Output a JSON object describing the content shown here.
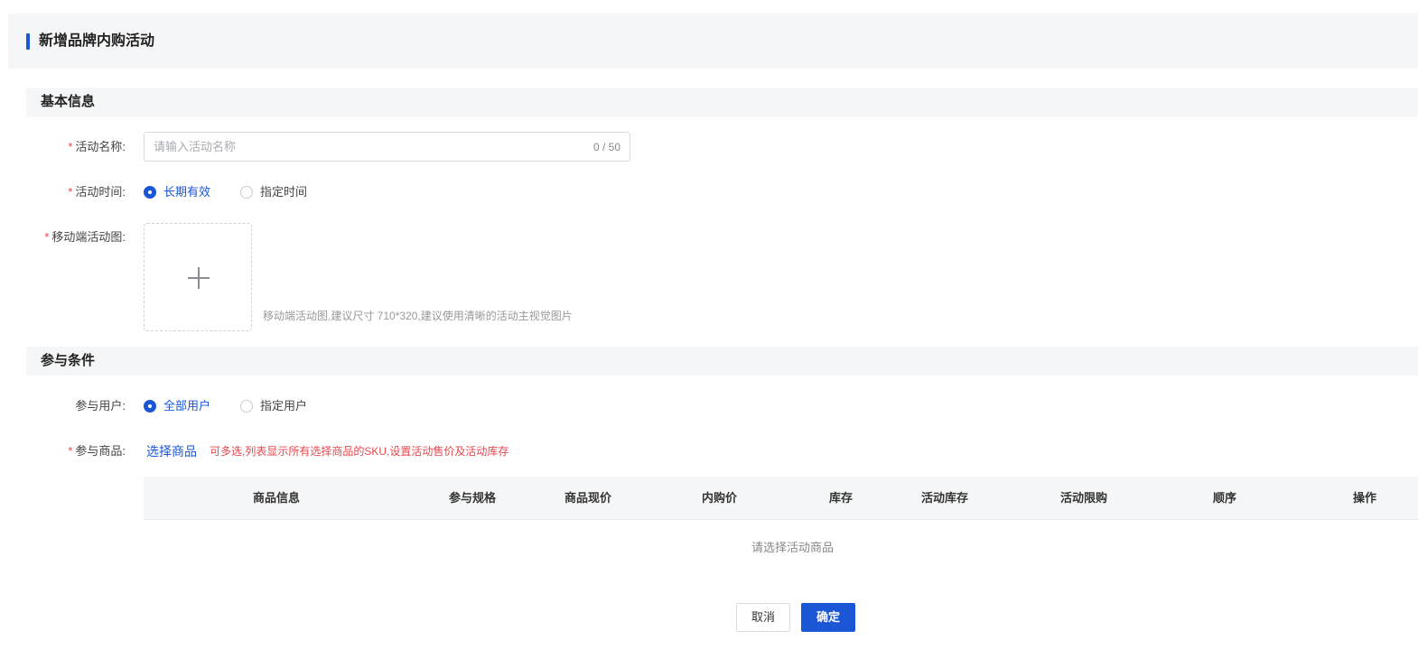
{
  "page": {
    "title": "新增品牌内购活动"
  },
  "sections": {
    "basic": "基本信息",
    "conditions": "参与条件"
  },
  "form": {
    "required_mark": "*",
    "name_label": "活动名称:",
    "name_placeholder": "请输入活动名称",
    "name_value": "",
    "name_counter": "0 / 50",
    "time_label": "活动时间:",
    "time_options": [
      {
        "label": "长期有效",
        "checked": true
      },
      {
        "label": "指定时间",
        "checked": false
      }
    ],
    "image_label": "移动端活动图:",
    "image_tip": "移动端活动图,建议尺寸 710*320,建议使用清晰的活动主视觉图片",
    "users_label": "参与用户:",
    "user_options": [
      {
        "label": "全部用户",
        "checked": true
      },
      {
        "label": "指定用户",
        "checked": false
      }
    ],
    "goods_label": "参与商品:",
    "select_goods": "选择商品",
    "goods_tip": "可多选,列表显示所有选择商品的SKU,设置活动售价及活动库存"
  },
  "table": {
    "columns": [
      "商品信息",
      "参与规格",
      "商品现价",
      "内购价",
      "库存",
      "活动库存",
      "活动限购",
      "顺序",
      "操作"
    ],
    "empty": "请选择活动商品"
  },
  "actions": {
    "cancel": "取消",
    "confirm": "确定"
  },
  "colors": {
    "primary": "#1a56d6",
    "required": "#e5484d",
    "header_bg": "#f5f6f7"
  }
}
